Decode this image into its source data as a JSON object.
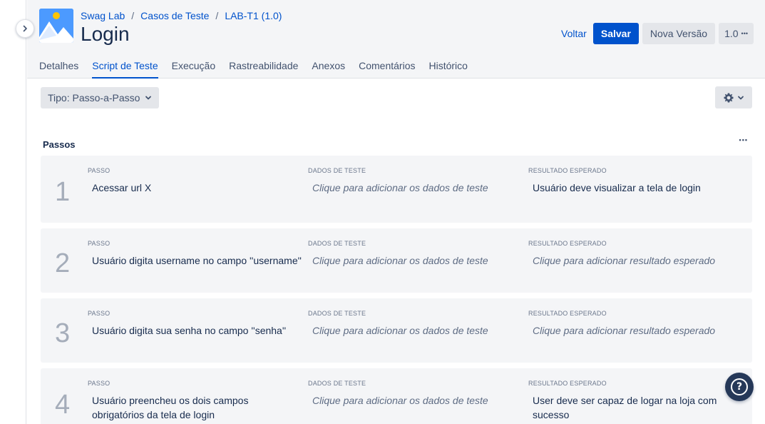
{
  "breadcrumb": {
    "project": "Swag Lab",
    "section": "Casos de Teste",
    "item": "LAB-T1 (1.0)"
  },
  "page": {
    "title": "Login"
  },
  "actions": {
    "back_label": "Voltar",
    "save_label": "Salvar",
    "new_version_label": "Nova Versão",
    "version_label": "1.0",
    "more_glyph": "•••"
  },
  "tabs": [
    {
      "label": "Detalhes",
      "active": false
    },
    {
      "label": "Script de Teste",
      "active": true
    },
    {
      "label": "Execução",
      "active": false
    },
    {
      "label": "Rastreabilidade",
      "active": false
    },
    {
      "label": "Anexos",
      "active": false
    },
    {
      "label": "Comentários",
      "active": false
    },
    {
      "label": "Histórico",
      "active": false
    }
  ],
  "toolbar": {
    "type_select_value": "Tipo: Passo-a-Passo",
    "settings_icon": "gear-icon"
  },
  "steps_section": {
    "title": "Passos",
    "more_glyph": "•••"
  },
  "column_labels": {
    "step": "PASSO",
    "test_data": "DADOS DE TESTE",
    "expected": "RESULTADO ESPERADO"
  },
  "steps": [
    {
      "number": "1",
      "step": "Acessar url X",
      "test_data": "Clique para adicionar os dados de teste",
      "expected": "Usuário deve visualizar a tela de login"
    },
    {
      "number": "2",
      "step": "Usuário digita username no campo ''username''",
      "test_data": "Clique para adicionar os dados de teste",
      "expected": "Clique para adicionar resultado esperado"
    },
    {
      "number": "3",
      "step": "Usuário digita sua senha no campo ''senha''",
      "test_data": "Clique para adicionar os dados de teste",
      "expected": "Clique para adicionar resultado esperado"
    },
    {
      "number": "4",
      "step": "Usuário preencheu os dois campos obrigatórios da tela de login",
      "test_data": "Clique para adicionar os dados de teste",
      "expected": "User deve ser capaz de logar na loja com sucesso"
    }
  ],
  "help": {
    "glyph": "?"
  },
  "colors": {
    "brand_blue": "#0052cc",
    "header_bg": "#f4f5f7",
    "card_bg": "#f4f5f7",
    "help_bg": "#253858"
  }
}
